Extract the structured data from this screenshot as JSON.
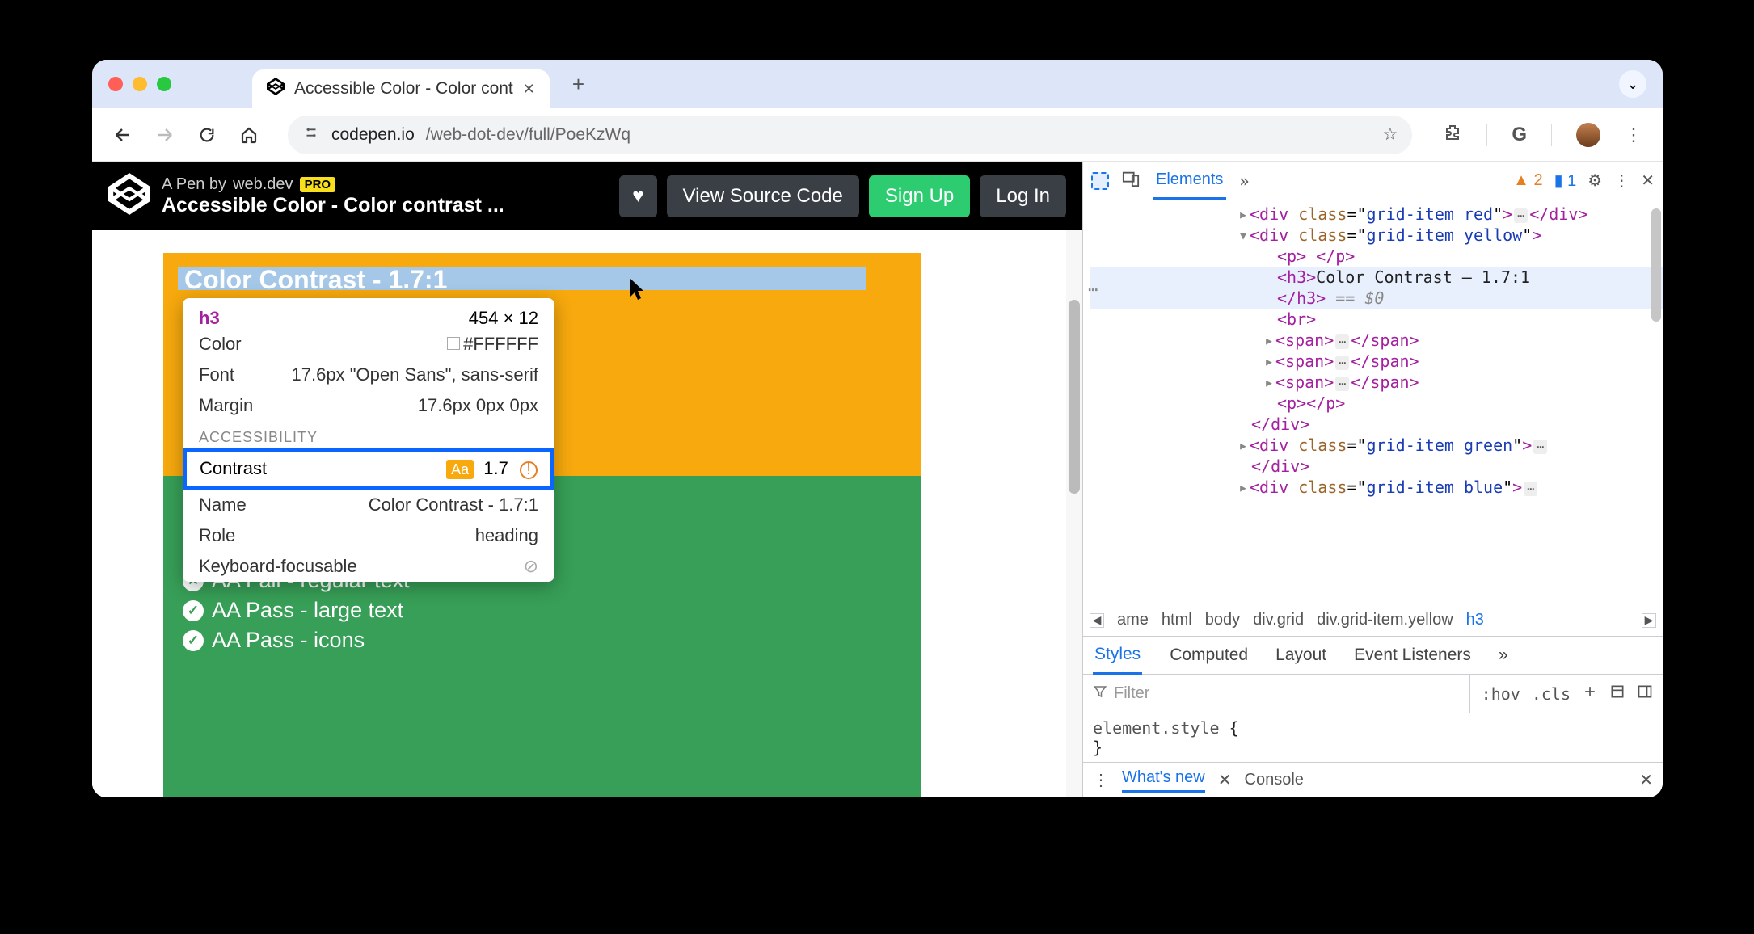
{
  "tab": {
    "title": "Accessible Color - Color cont"
  },
  "url": {
    "host": "codepen.io",
    "path": "/web-dot-dev/full/PoeKzWq"
  },
  "codepen": {
    "byline_prefix": "A Pen by",
    "byline_author": "web.dev",
    "pro": "PRO",
    "title": "Accessible Color - Color contrast ...",
    "heart": "♥",
    "view_source": "View Source Code",
    "sign_up": "Sign Up",
    "log_in": "Log In"
  },
  "page": {
    "highlight_text": "Color Contrast - 1.7:1",
    "green_rows": [
      {
        "pass": false,
        "label": "AA Fail - regular text"
      },
      {
        "pass": true,
        "label": "AA Pass - large text"
      },
      {
        "pass": true,
        "label": "AA Pass - icons"
      }
    ]
  },
  "tooltip": {
    "tag": "h3",
    "dims": "454 × 12",
    "color_label": "Color",
    "color_value": "#FFFFFF",
    "font_label": "Font",
    "font_value": "17.6px \"Open Sans\", sans-serif",
    "margin_label": "Margin",
    "margin_value": "17.6px 0px 0px",
    "a11y_label": "ACCESSIBILITY",
    "contrast_label": "Contrast",
    "contrast_badge": "Aa",
    "contrast_value": "1.7",
    "name_label": "Name",
    "name_value": "Color Contrast - 1.7:1",
    "role_label": "Role",
    "role_value": "heading",
    "kb_label": "Keyboard-focusable"
  },
  "devtools": {
    "tabs": {
      "elements": "Elements",
      "warn_count": "2",
      "issue_count": "1"
    },
    "dom": {
      "l1": {
        "c": "grid-item red"
      },
      "l2": {
        "c": "grid-item yellow"
      },
      "h3_text": "Color Contrast – 1.7:1",
      "eq0": "== $0",
      "l_green": {
        "c": "grid-item green"
      },
      "l_blue": {
        "c": "grid-item blue"
      }
    },
    "breadcrumb": {
      "cut": "ame",
      "items": [
        "html",
        "body",
        "div.grid",
        "div.grid-item.yellow",
        "h3"
      ]
    },
    "styles_tabs": {
      "styles": "Styles",
      "computed": "Computed",
      "layout": "Layout",
      "listeners": "Event Listeners"
    },
    "filter": {
      "placeholder": "Filter",
      "hov": ":hov",
      "cls": ".cls"
    },
    "styles_body": {
      "sel": "element.style",
      "open": "{",
      "close": "}"
    },
    "drawer": {
      "whatsnew": "What's new",
      "console": "Console"
    }
  }
}
